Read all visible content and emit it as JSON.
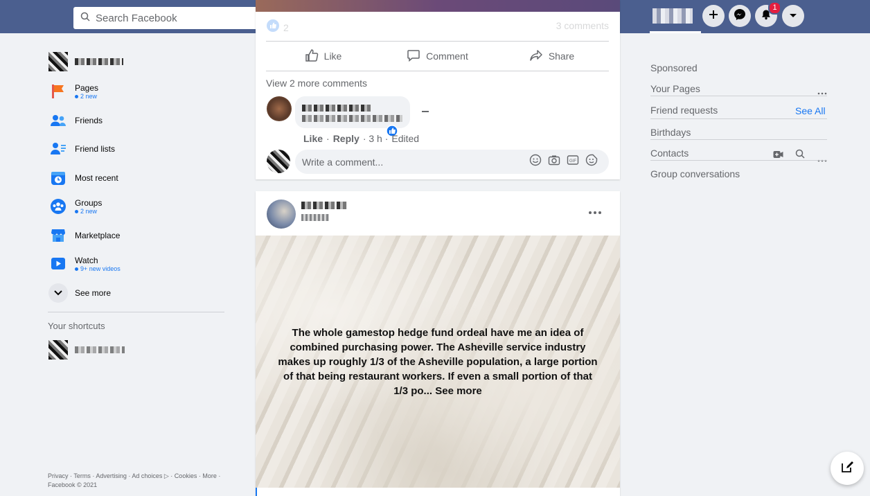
{
  "header": {
    "search_placeholder": "Search Facebook",
    "notification_count": "1"
  },
  "left_nav": {
    "items": [
      {
        "label": "Pages",
        "sub": "2 new"
      },
      {
        "label": "Friends"
      },
      {
        "label": "Friend lists"
      },
      {
        "label": "Most recent"
      },
      {
        "label": "Groups",
        "sub": "2 new"
      },
      {
        "label": "Marketplace"
      },
      {
        "label": "Watch",
        "sub": "9+ new videos"
      },
      {
        "label": "See more"
      }
    ],
    "shortcuts_title": "Your shortcuts",
    "footer": "Privacy · Terms · Advertising · Ad choices ▷ · Cookies · More · Facebook © 2021"
  },
  "post1": {
    "reaction_count": "2",
    "comments_count": "3 comments",
    "actions": {
      "like": "Like",
      "comment": "Comment",
      "share": "Share"
    },
    "view_more": "View 2 more comments",
    "comment_meta": {
      "like": "Like",
      "reply": "Reply",
      "time": "· 3 h ·",
      "edited": "Edited"
    },
    "comment_placeholder": "Write a comment..."
  },
  "post2": {
    "text": "The whole gamestop hedge fund ordeal have me an idea of combined purchasing power. The Asheville service industry makes up roughly 1/3 of the Asheville population, a large portion of that being restaurant workers. If even a small portion of that 1/3 po...",
    "see_more": "See more"
  },
  "right_sidebar": {
    "sponsored": "Sponsored",
    "your_pages": "Your Pages",
    "friend_requests": "Friend requests",
    "see_all": "See All",
    "birthdays": "Birthdays",
    "contacts": "Contacts",
    "group_conversations": "Group conversations"
  },
  "colors": {
    "topbar": "#4b5f8f",
    "accent": "#1877f2",
    "page_bg": "#f0f2f5"
  }
}
